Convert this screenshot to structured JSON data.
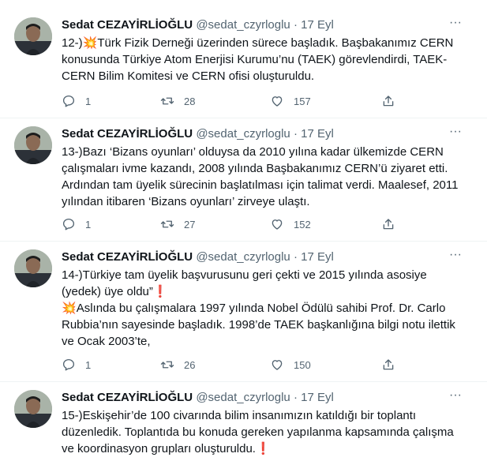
{
  "colors": {
    "text": "#0f1419",
    "muted": "#536471",
    "divider": "#eff3f4",
    "accent": "#e0245e"
  },
  "tweets": [
    {
      "name": "Sedat CEZAYİRLİOĞLU",
      "handle": "@sedat_czyrloglu",
      "separator": "·",
      "date": "17 Eyl",
      "more": "···",
      "icons": [
        "collision-emoji"
      ],
      "paragraphs": [
        {
          "prefix": "12-)",
          "emoji": "💥",
          "text": "Türk Fizik Derneği üzerinden sürece başladık. Başbakanımız CERN konusunda Türkiye Atom Enerjisi Kurumu’nu (TAEK) görevlendirdi, TAEK-CERN Bilim Komitesi ve CERN ofisi oluşturuldu."
        }
      ],
      "replies": "1",
      "retweets": "28",
      "likes": "157"
    },
    {
      "name": "Sedat CEZAYİRLİOĞLU",
      "handle": "@sedat_czyrloglu",
      "separator": "·",
      "date": "17 Eyl",
      "more": "···",
      "paragraphs": [
        {
          "text": "13-)Bazı ‘Bizans oyunları’ olduysa da 2010 yılına kadar ülkemizde CERN çalışmaları ivme kazandı, 2008 yılında Başbakanımız CERN’ü ziyaret etti. Ardından tam üyelik sürecinin başlatılması için talimat verdi. Maalesef, 2011 yılından itibaren ‘Bizans oyunları’ zirveye ulaştı."
        }
      ],
      "replies": "1",
      "retweets": "27",
      "likes": "152"
    },
    {
      "name": "Sedat CEZAYİRLİOĞLU",
      "handle": "@sedat_czyrloglu",
      "separator": "·",
      "date": "17 Eyl",
      "more": "···",
      "icons": [
        "exclamation-emoji",
        "collision-emoji"
      ],
      "paragraphs": [
        {
          "text": "14-)Türkiye tam üyelik başvurusunu geri çekti ve 2015 yılında asosiye (yedek) üye oldu”",
          "suffix": "❗"
        },
        {
          "emoji": "💥",
          "text": "Aslında bu çalışmalara 1997 yılında Nobel Ödülü sahibi Prof. Dr. Carlo Rubbia’nın sayesinde başladık. 1998’de TAEK başkanlığına bilgi notu ilettik ve Ocak 2003’te,"
        }
      ],
      "replies": "1",
      "retweets": "26",
      "likes": "150"
    },
    {
      "name": "Sedat CEZAYİRLİOĞLU",
      "handle": "@sedat_czyrloglu",
      "separator": "·",
      "date": "17 Eyl",
      "more": "···",
      "icons": [
        "exclamation-emoji"
      ],
      "paragraphs": [
        {
          "text": "15-)Eskişehir’de 100 civarında bilim insanımızın katıldığı bir toplantı düzenledik. Toplantıda bu konuda gereken yapılanma kapsamında çalışma ve koordinasyon grupları oluşturuldu.",
          "suffix": "❗"
        }
      ]
    }
  ]
}
